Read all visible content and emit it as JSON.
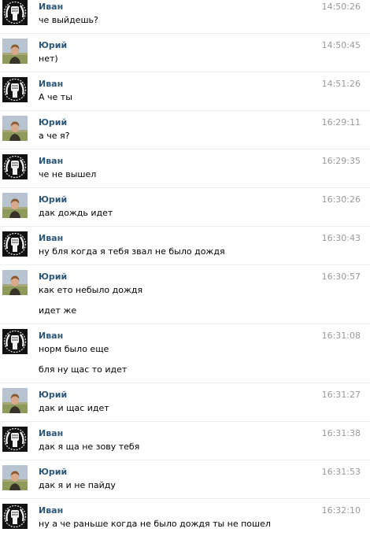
{
  "messages": [
    {
      "author": "Иван",
      "avatar": "ivan",
      "time": "14:50:26",
      "lines": [
        "че выйдешь?"
      ]
    },
    {
      "author": "Юрий",
      "avatar": "yuri",
      "time": "14:50:45",
      "lines": [
        "нет)"
      ]
    },
    {
      "author": "Иван",
      "avatar": "ivan",
      "time": "14:51:26",
      "lines": [
        "А че ты"
      ]
    },
    {
      "author": "Юрий",
      "avatar": "yuri",
      "time": "16:29:11",
      "lines": [
        "а че я?"
      ]
    },
    {
      "author": "Иван",
      "avatar": "ivan",
      "time": "16:29:35",
      "lines": [
        "че не вышел"
      ]
    },
    {
      "author": "Юрий",
      "avatar": "yuri",
      "time": "16:30:26",
      "lines": [
        "дак дождь идет"
      ]
    },
    {
      "author": "Иван",
      "avatar": "ivan",
      "time": "16:30:43",
      "lines": [
        "ну бля когда я тебя звал не было дождя"
      ]
    },
    {
      "author": "Юрий",
      "avatar": "yuri",
      "time": "16:30:57",
      "lines": [
        "как ето небыло дождя",
        "идет же"
      ]
    },
    {
      "author": "Иван",
      "avatar": "ivan",
      "time": "16:31:08",
      "lines": [
        "норм было еще",
        "бля ну щас то идет"
      ]
    },
    {
      "author": "Юрий",
      "avatar": "yuri",
      "time": "16:31:27",
      "lines": [
        "дак и щас идет"
      ]
    },
    {
      "author": "Иван",
      "avatar": "ivan",
      "time": "16:31:38",
      "lines": [
        "дак я ща не зову тебя"
      ]
    },
    {
      "author": "Юрий",
      "avatar": "yuri",
      "time": "16:31:53",
      "lines": [
        "дак я и не пайду"
      ]
    },
    {
      "author": "Иван",
      "avatar": "ivan",
      "time": "16:32:10",
      "lines": [
        "ну а че раньше когда не было дождя ты не пошел"
      ]
    }
  ]
}
